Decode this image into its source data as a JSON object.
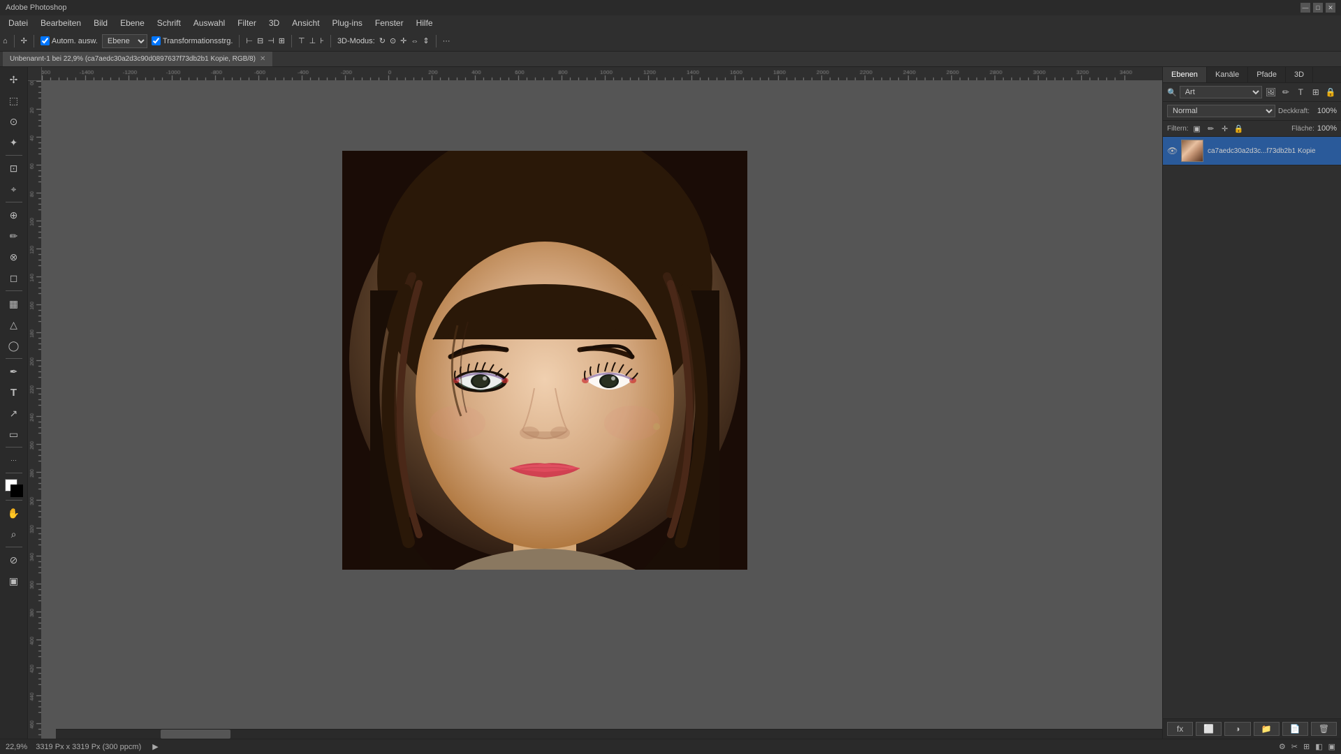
{
  "titlebar": {
    "title": "Adobe Photoshop",
    "min": "—",
    "max": "□",
    "close": "✕"
  },
  "menubar": {
    "items": [
      "Datei",
      "Bearbeiten",
      "Bild",
      "Ebene",
      "Schrift",
      "Auswahl",
      "Filter",
      "3D",
      "Ansicht",
      "Plug-ins",
      "Fenster",
      "Hilfe"
    ]
  },
  "toolbar": {
    "home_icon": "⌂",
    "move_tool_label": "Autom. ausw.",
    "ebene_label": "Ebene",
    "transform_checkbox_label": "Transformationsstrg.",
    "mode_3d": "3D-Modus:",
    "more_btn": "···"
  },
  "document_tab": {
    "name": "Unbenannt-1 bei 22,9% (ca7aedc30a2d3c90d0897637f73db2b1 Kopie, RGB/8)",
    "close": "✕"
  },
  "canvas": {
    "zoom": "22,9%",
    "dimensions": "3319 Px x 3319 Px (300 ppcm)"
  },
  "right_panel": {
    "tabs": [
      "Ebenen",
      "Kanäle",
      "Pfade",
      "3D"
    ],
    "active_tab": "Ebenen",
    "filter_placeholder": "Art",
    "blend_mode": "Normal",
    "opacity_label": "Deckkraft:",
    "opacity_value": "100%",
    "fill_label": "Fläche:",
    "fill_value": "100%",
    "filter_label": "Filtern:",
    "layer_name": "ca7aedc30a2d3c...f73db2b1 Kopie"
  },
  "layers": [
    {
      "id": "layer-1",
      "name": "ca7aedc30a2d3c...f73db2b1 Kopie",
      "visible": true,
      "selected": true
    }
  ],
  "status_bar": {
    "zoom": "22,9%",
    "dimensions": "3319 Px x 3319 Px (300 ppcm)",
    "nav_arrow": "▶"
  },
  "tools": [
    {
      "id": "move",
      "icon": "move-icon",
      "symbol": "✢"
    },
    {
      "id": "select-rect",
      "icon": "select-rect-icon",
      "symbol": "⬚"
    },
    {
      "id": "lasso",
      "icon": "lasso-icon",
      "symbol": "⊙"
    },
    {
      "id": "magic-wand",
      "icon": "magic-wand-icon",
      "symbol": "✦"
    },
    {
      "id": "crop",
      "icon": "crop-icon",
      "symbol": "⊡"
    },
    {
      "id": "eyedrop",
      "icon": "eyedrop-icon",
      "symbol": "⌖"
    },
    {
      "id": "heal",
      "icon": "heal-icon",
      "symbol": "⊕"
    },
    {
      "id": "brush",
      "icon": "brush-icon",
      "symbol": "✏"
    },
    {
      "id": "stamp",
      "icon": "stamp-icon",
      "symbol": "⊗"
    },
    {
      "id": "eraser",
      "icon": "eraser-icon",
      "symbol": "◻"
    },
    {
      "id": "gradient",
      "icon": "gradient-icon",
      "symbol": "▦"
    },
    {
      "id": "blur",
      "icon": "blur-icon",
      "symbol": "△"
    },
    {
      "id": "dodge",
      "icon": "dodge-icon",
      "symbol": "◯"
    },
    {
      "id": "pen",
      "icon": "pen-icon",
      "symbol": "✒"
    },
    {
      "id": "text",
      "icon": "text-icon",
      "symbol": "T"
    },
    {
      "id": "path-select",
      "icon": "path-select-icon",
      "symbol": "↗"
    },
    {
      "id": "shape",
      "icon": "shape-icon",
      "symbol": "▭"
    },
    {
      "id": "hand",
      "icon": "hand-icon",
      "symbol": "✋"
    },
    {
      "id": "zoom",
      "icon": "zoom-icon",
      "symbol": "⌕"
    },
    {
      "id": "extra",
      "icon": "extra-icon",
      "symbol": "···"
    }
  ],
  "colors": {
    "fg": "#000000",
    "bg": "#ffffff",
    "accent_blue": "#2a5a9a",
    "toolbar_bg": "#2f2f2f",
    "canvas_bg": "#444444",
    "panel_bg": "#2f2f2f",
    "dark_bg": "#2a2a2a"
  }
}
